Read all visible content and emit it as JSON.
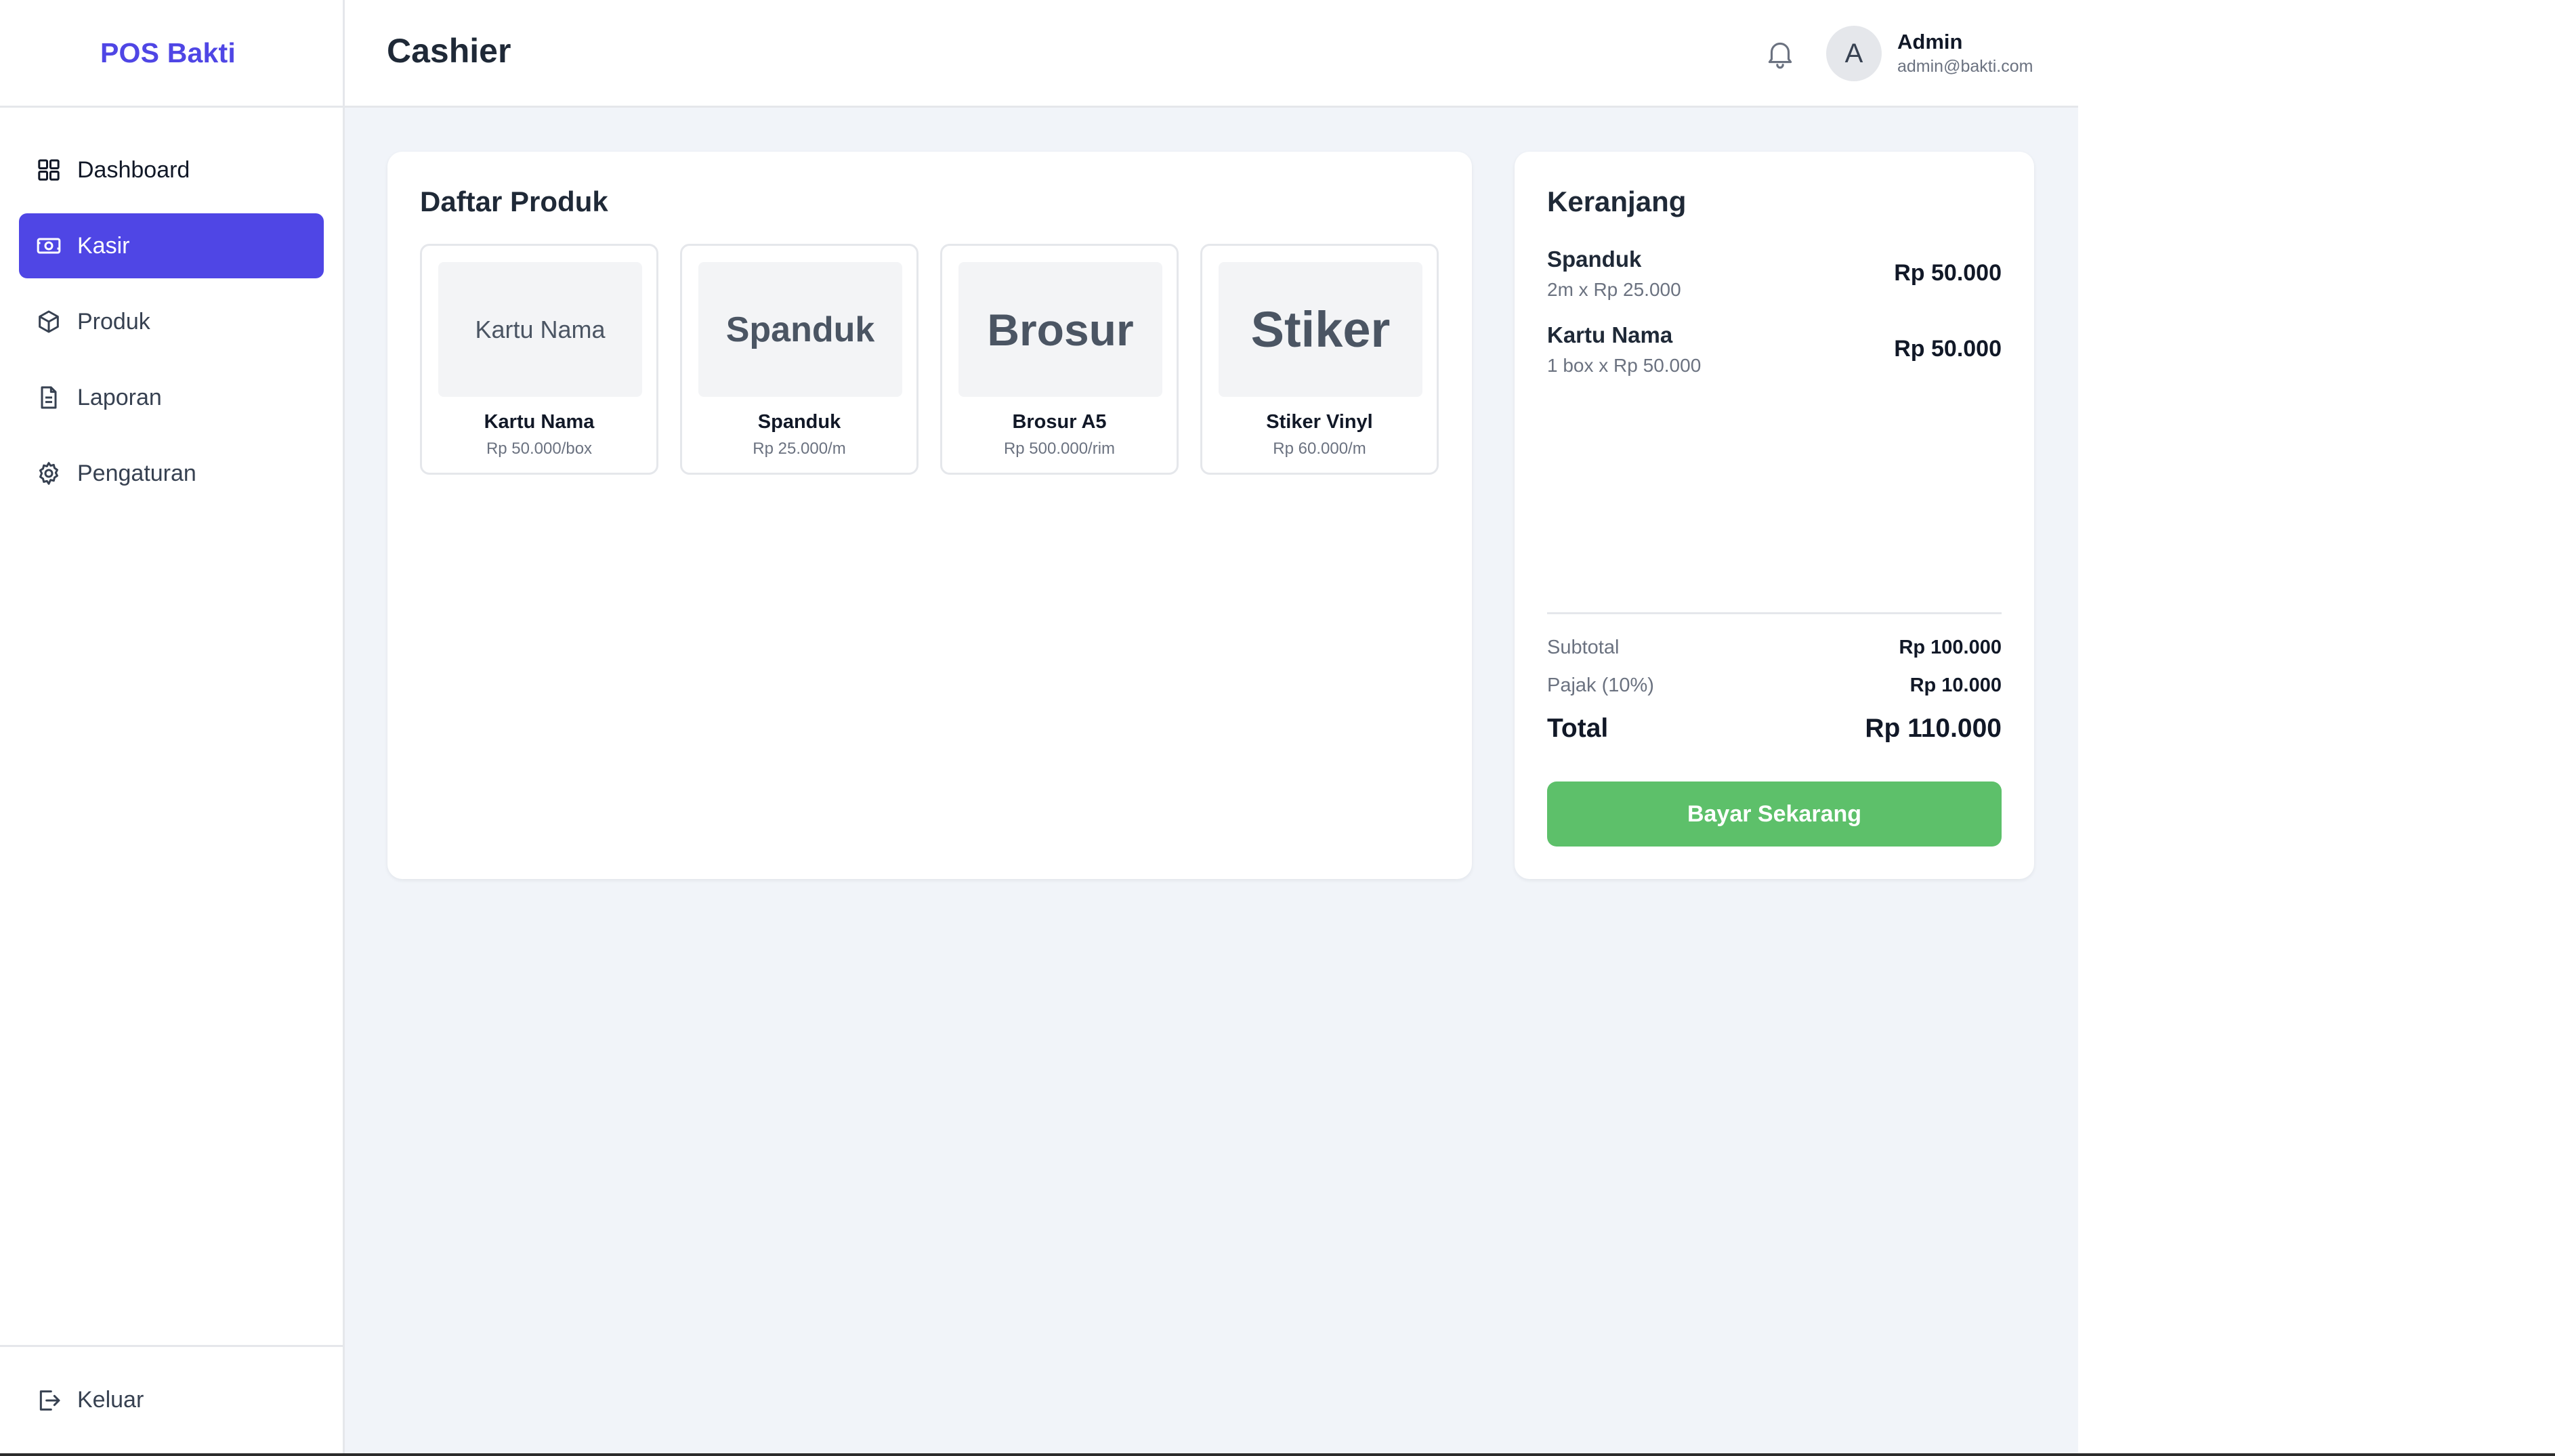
{
  "sidebar": {
    "brand": "POS Bakti",
    "items": [
      {
        "label": "Dashboard",
        "icon": "dashboard-grid-icon"
      },
      {
        "label": "Kasir",
        "icon": "cash-register-icon",
        "active": true
      },
      {
        "label": "Produk",
        "icon": "box-icon"
      },
      {
        "label": "Laporan",
        "icon": "document-icon"
      },
      {
        "label": "Pengaturan",
        "icon": "gear-icon"
      }
    ],
    "logout_label": "Keluar",
    "logout_icon": "logout-icon"
  },
  "header": {
    "title": "Cashier",
    "bell_icon": "bell-icon",
    "user": {
      "initial": "A",
      "name": "Admin",
      "email": "admin@bakti.com"
    }
  },
  "products": {
    "title": "Daftar Produk",
    "items": [
      {
        "thumb": "Kartu Nama",
        "name": "Kartu Nama",
        "price": "Rp 50.000/box"
      },
      {
        "thumb": "Spanduk",
        "name": "Spanduk",
        "price": "Rp 25.000/m"
      },
      {
        "thumb": "Brosur",
        "name": "Brosur A5",
        "price": "Rp 500.000/rim"
      },
      {
        "thumb": "Stiker",
        "name": "Stiker Vinyl",
        "price": "Rp 60.000/m"
      }
    ]
  },
  "cart": {
    "title": "Keranjang",
    "items": [
      {
        "name": "Spanduk",
        "detail": "2m x Rp 25.000",
        "total": "Rp 50.000"
      },
      {
        "name": "Kartu Nama",
        "detail": "1 box x Rp 50.000",
        "total": "Rp 50.000"
      }
    ],
    "subtotal_label": "Subtotal",
    "subtotal_value": "Rp 100.000",
    "tax_label": "Pajak (10%)",
    "tax_value": "Rp 10.000",
    "total_label": "Total",
    "total_value": "Rp 110.000",
    "pay_label": "Bayar Sekarang"
  },
  "colors": {
    "brand": "#4f46e5",
    "active_nav": "#4f46e5",
    "pay_button": "#5dc06a",
    "background": "#f1f4f9"
  }
}
